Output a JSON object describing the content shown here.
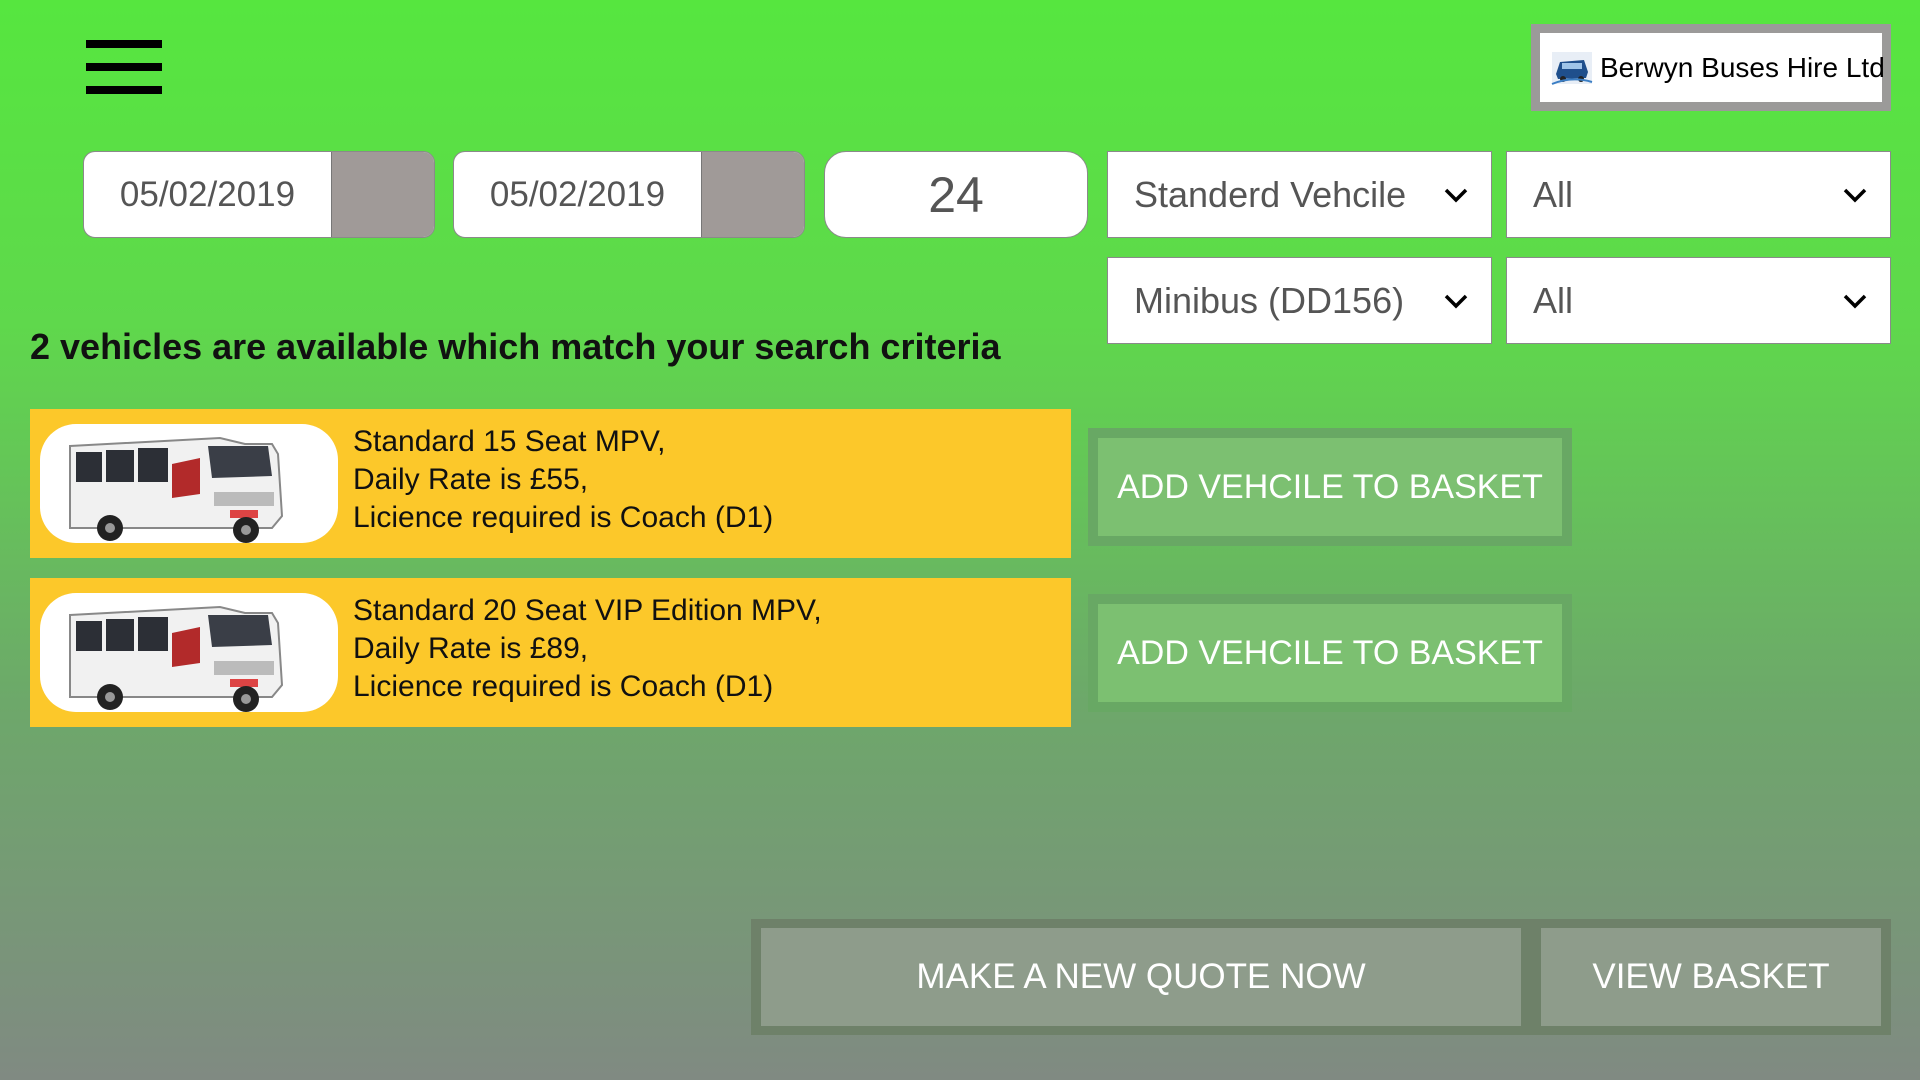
{
  "header": {
    "menu_icon": "hamburger-menu-icon",
    "logo_text": "Berwyn Buses Hire Ltd"
  },
  "search": {
    "start_date": "05/02/2019",
    "end_date": "05/02/2019",
    "hours": "24",
    "vehicle_type": "Standerd Vehcile",
    "vehicle_model": "Minibus (DD156)",
    "filter_1": "All",
    "filter_2": "All"
  },
  "results": {
    "message": "2 vehicles are available which match your search criteria",
    "vehicles": [
      {
        "name": "Standard 15 Seat MPV,",
        "rate": "Daily Rate is £55,",
        "licence": "Licience required is Coach (D1)",
        "button": "ADD VEHCILE TO BASKET"
      },
      {
        "name": "Standard 20 Seat VIP Edition MPV,",
        "rate": "Daily Rate is £89,",
        "licence": "Licience required is Coach (D1)",
        "button": "ADD VEHCILE TO BASKET"
      }
    ]
  },
  "footer": {
    "new_quote": "MAKE A NEW QUOTE NOW",
    "view_basket": "VIEW BASKET"
  },
  "colors": {
    "background_top": "#56e63f",
    "card": "#fcc82a",
    "add_button": "#7cc071",
    "footer_button": "#8e9c8b"
  }
}
